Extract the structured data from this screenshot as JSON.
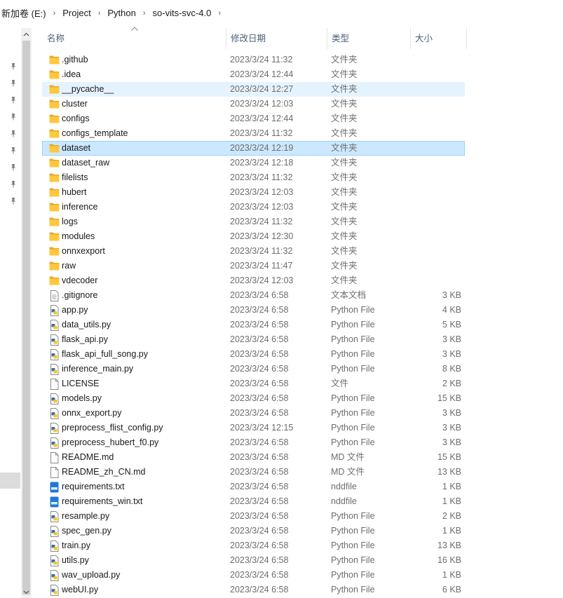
{
  "breadcrumb": [
    {
      "label": "新加卷 (E:)"
    },
    {
      "label": "Project"
    },
    {
      "label": "Python"
    },
    {
      "label": "so-vits-svc-4.0"
    }
  ],
  "columns": {
    "name": "名称",
    "date": "修改日期",
    "type": "类型",
    "size": "大小"
  },
  "files": [
    {
      "name": ".github",
      "date": "2023/3/24 11:32",
      "type": "文件夹",
      "size": "",
      "icon": "folder-icon"
    },
    {
      "name": ".idea",
      "date": "2023/3/24 12:44",
      "type": "文件夹",
      "size": "",
      "icon": "folder-icon"
    },
    {
      "name": "__pycache__",
      "date": "2023/3/24 12:27",
      "type": "文件夹",
      "size": "",
      "icon": "folder-icon",
      "state": "hover"
    },
    {
      "name": "cluster",
      "date": "2023/3/24 12:03",
      "type": "文件夹",
      "size": "",
      "icon": "folder-icon"
    },
    {
      "name": "configs",
      "date": "2023/3/24 12:44",
      "type": "文件夹",
      "size": "",
      "icon": "folder-icon"
    },
    {
      "name": "configs_template",
      "date": "2023/3/24 11:32",
      "type": "文件夹",
      "size": "",
      "icon": "folder-icon"
    },
    {
      "name": "dataset",
      "date": "2023/3/24 12:19",
      "type": "文件夹",
      "size": "",
      "icon": "folder-icon",
      "state": "selected"
    },
    {
      "name": "dataset_raw",
      "date": "2023/3/24 12:18",
      "type": "文件夹",
      "size": "",
      "icon": "folder-icon"
    },
    {
      "name": "filelists",
      "date": "2023/3/24 11:32",
      "type": "文件夹",
      "size": "",
      "icon": "folder-icon"
    },
    {
      "name": "hubert",
      "date": "2023/3/24 12:03",
      "type": "文件夹",
      "size": "",
      "icon": "folder-icon"
    },
    {
      "name": "inference",
      "date": "2023/3/24 12:03",
      "type": "文件夹",
      "size": "",
      "icon": "folder-icon"
    },
    {
      "name": "logs",
      "date": "2023/3/24 11:32",
      "type": "文件夹",
      "size": "",
      "icon": "folder-icon"
    },
    {
      "name": "modules",
      "date": "2023/3/24 12:30",
      "type": "文件夹",
      "size": "",
      "icon": "folder-icon"
    },
    {
      "name": "onnxexport",
      "date": "2023/3/24 11:32",
      "type": "文件夹",
      "size": "",
      "icon": "folder-icon"
    },
    {
      "name": "raw",
      "date": "2023/3/24 11:47",
      "type": "文件夹",
      "size": "",
      "icon": "folder-icon"
    },
    {
      "name": "vdecoder",
      "date": "2023/3/24 12:03",
      "type": "文件夹",
      "size": "",
      "icon": "folder-icon"
    },
    {
      "name": ".gitignore",
      "date": "2023/3/24 6:58",
      "type": "文本文档",
      "size": "3 KB",
      "icon": "text-file-icon"
    },
    {
      "name": "app.py",
      "date": "2023/3/24 6:58",
      "type": "Python File",
      "size": "4 KB",
      "icon": "python-file-icon"
    },
    {
      "name": "data_utils.py",
      "date": "2023/3/24 6:58",
      "type": "Python File",
      "size": "5 KB",
      "icon": "python-file-icon"
    },
    {
      "name": "flask_api.py",
      "date": "2023/3/24 6:58",
      "type": "Python File",
      "size": "3 KB",
      "icon": "python-file-icon"
    },
    {
      "name": "flask_api_full_song.py",
      "date": "2023/3/24 6:58",
      "type": "Python File",
      "size": "3 KB",
      "icon": "python-file-icon"
    },
    {
      "name": "inference_main.py",
      "date": "2023/3/24 6:58",
      "type": "Python File",
      "size": "8 KB",
      "icon": "python-file-icon"
    },
    {
      "name": "LICENSE",
      "date": "2023/3/24 6:58",
      "type": "文件",
      "size": "2 KB",
      "icon": "blank-file-icon"
    },
    {
      "name": "models.py",
      "date": "2023/3/24 6:58",
      "type": "Python File",
      "size": "15 KB",
      "icon": "python-file-icon"
    },
    {
      "name": "onnx_export.py",
      "date": "2023/3/24 6:58",
      "type": "Python File",
      "size": "3 KB",
      "icon": "python-file-icon"
    },
    {
      "name": "preprocess_flist_config.py",
      "date": "2023/3/24 12:15",
      "type": "Python File",
      "size": "3 KB",
      "icon": "python-file-icon"
    },
    {
      "name": "preprocess_hubert_f0.py",
      "date": "2023/3/24 6:58",
      "type": "Python File",
      "size": "3 KB",
      "icon": "python-file-icon"
    },
    {
      "name": "README.md",
      "date": "2023/3/24 6:58",
      "type": "MD 文件",
      "size": "15 KB",
      "icon": "blank-file-icon"
    },
    {
      "name": "README_zh_CN.md",
      "date": "2023/3/24 6:58",
      "type": "MD 文件",
      "size": "13 KB",
      "icon": "blank-file-icon"
    },
    {
      "name": "requirements.txt",
      "date": "2023/3/24 6:58",
      "type": "nddfile",
      "size": "1 KB",
      "icon": "txt-file-icon"
    },
    {
      "name": "requirements_win.txt",
      "date": "2023/3/24 6:58",
      "type": "nddfile",
      "size": "1 KB",
      "icon": "txt-file-icon"
    },
    {
      "name": "resample.py",
      "date": "2023/3/24 6:58",
      "type": "Python File",
      "size": "2 KB",
      "icon": "python-file-icon"
    },
    {
      "name": "spec_gen.py",
      "date": "2023/3/24 6:58",
      "type": "Python File",
      "size": "1 KB",
      "icon": "python-file-icon"
    },
    {
      "name": "train.py",
      "date": "2023/3/24 6:58",
      "type": "Python File",
      "size": "13 KB",
      "icon": "python-file-icon"
    },
    {
      "name": "utils.py",
      "date": "2023/3/24 6:58",
      "type": "Python File",
      "size": "16 KB",
      "icon": "python-file-icon"
    },
    {
      "name": "wav_upload.py",
      "date": "2023/3/24 6:58",
      "type": "Python File",
      "size": "1 KB",
      "icon": "python-file-icon"
    },
    {
      "name": "webUI.py",
      "date": "2023/3/24 6:58",
      "type": "Python File",
      "size": "6 KB",
      "icon": "python-file-icon"
    }
  ],
  "colors": {
    "folder": "#ffc83d",
    "folder_back": "#e8a825",
    "python_blue": "#3a6fa8",
    "python_yellow": "#f2c81e",
    "txt_blue": "#1e7ad6",
    "header_text": "#4c607a"
  }
}
